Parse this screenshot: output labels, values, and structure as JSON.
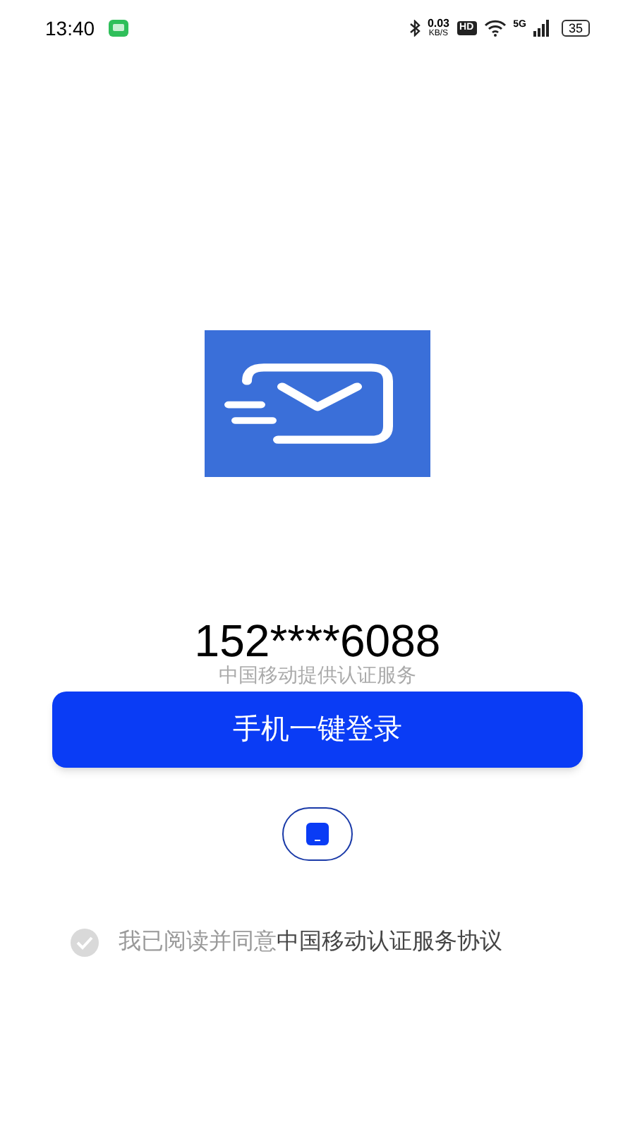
{
  "status_bar": {
    "time": "13:40",
    "net_speed": "0.03",
    "net_unit": "KB/S",
    "hd": "HD",
    "signal": "5G",
    "battery": "35"
  },
  "phone": "152****6088",
  "provider": "中国移动提供认证服务",
  "login_button": "手机一键登录",
  "agreement": {
    "checked": true,
    "prefix": "我已阅读并同意",
    "link": "中国移动认证服务协议"
  }
}
